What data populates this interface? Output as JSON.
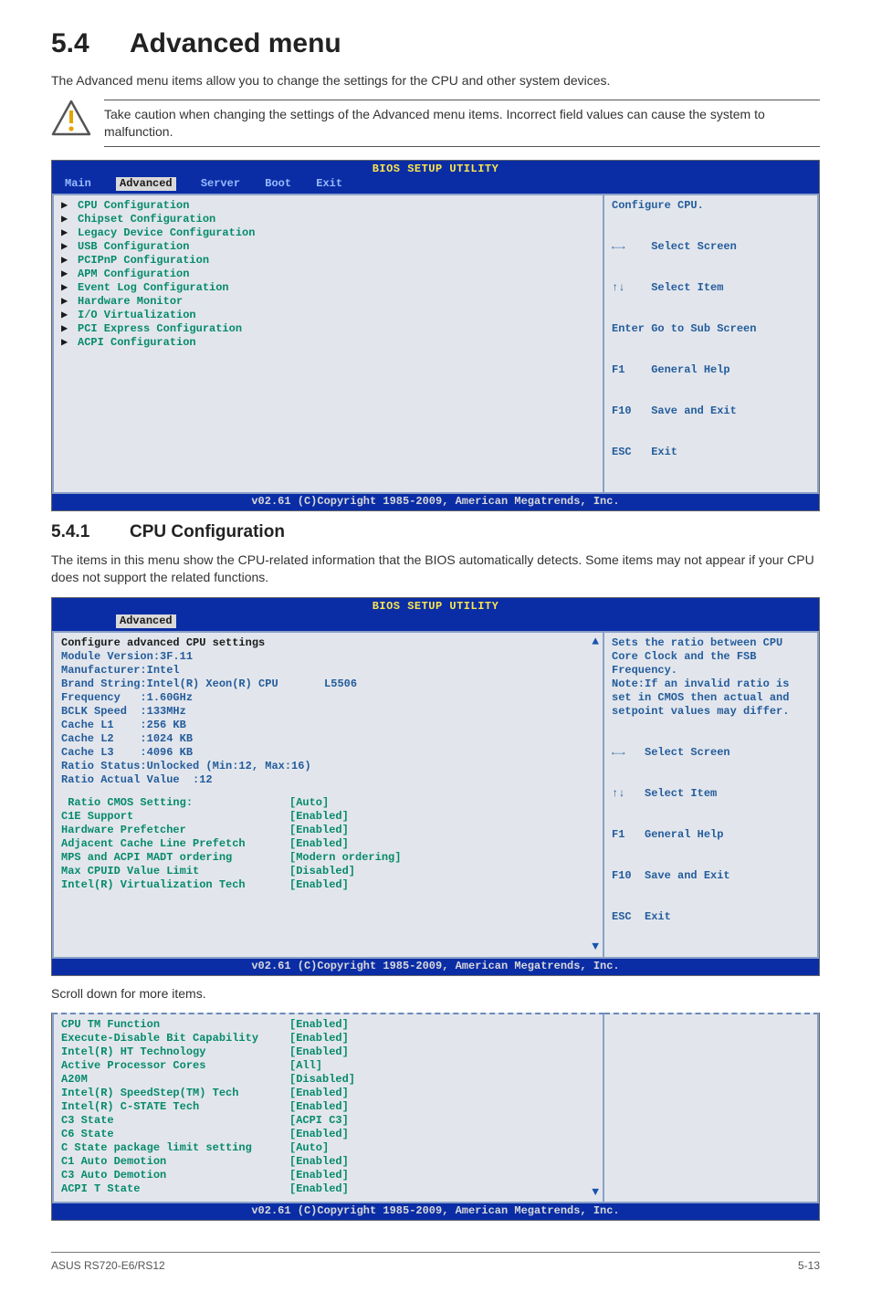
{
  "section": {
    "number": "5.4",
    "title": "Advanced menu"
  },
  "intro": "The Advanced menu items allow you to change the settings for the CPU and other system devices.",
  "note": "Take caution when changing the settings of the Advanced menu items. Incorrect field values can cause the system to malfunction.",
  "bios1": {
    "title": "BIOS SETUP UTILITY",
    "menus": [
      "Main",
      "Advanced",
      "Server",
      "Boot",
      "Exit"
    ],
    "selected_menu": "Advanced",
    "items": [
      "CPU Configuration",
      "Chipset Configuration",
      "Legacy Device Configuration",
      "USB Configuration",
      "PCIPnP Configuration",
      "APM Configuration",
      "Event Log Configuration",
      "Hardware Monitor",
      "I/O Virtualization",
      "PCI Express Configuration",
      "ACPI Configuration"
    ],
    "help_top": "Configure CPU.",
    "nav": [
      "←→    Select Screen",
      "↑↓    Select Item",
      "Enter Go to Sub Screen",
      "F1    General Help",
      "F10   Save and Exit",
      "ESC   Exit"
    ],
    "footer": "v02.61 (C)Copyright 1985-2009, American Megatrends, Inc."
  },
  "subsection": {
    "number": "5.4.1",
    "title": "CPU Configuration"
  },
  "sub_intro": "The items in this menu show the CPU-related information that the BIOS automatically detects. Some items may not appear if your CPU does not support the related functions.",
  "bios2": {
    "title": "BIOS SETUP UTILITY",
    "selected_menu": "Advanced",
    "heading": "Configure advanced CPU settings",
    "module": "Module Version:3F.11",
    "info_lines": [
      "Manufacturer:Intel",
      "Brand String:Intel(R) Xeon(R) CPU       L5506",
      "Frequency   :1.60GHz",
      "BCLK Speed  :133MHz",
      "Cache L1    :256 KB",
      "Cache L2    :1024 KB",
      "Cache L3    :4096 KB",
      "Ratio Status:Unlocked (Min:12, Max:16)",
      "Ratio Actual Value  :12"
    ],
    "options": [
      {
        "label": " Ratio CMOS Setting:",
        "value": "[Auto]"
      },
      {
        "label": "C1E Support",
        "value": "[Enabled]"
      },
      {
        "label": "Hardware Prefetcher",
        "value": "[Enabled]"
      },
      {
        "label": "Adjacent Cache Line Prefetch",
        "value": "[Enabled]"
      },
      {
        "label": "MPS and ACPI MADT ordering",
        "value": "[Modern ordering]"
      },
      {
        "label": "Max CPUID Value Limit",
        "value": "[Disabled]"
      },
      {
        "label": "Intel(R) Virtualization Tech",
        "value": "[Enabled]"
      }
    ],
    "help_top": "Sets the ratio between CPU Core Clock and the FSB Frequency.\nNote:If an invalid ratio is set in CMOS then actual and setpoint values may differ.",
    "nav": [
      "←→   Select Screen",
      "↑↓   Select Item",
      "F1   General Help",
      "F10  Save and Exit",
      "ESC  Exit"
    ],
    "footer": "v02.61 (C)Copyright 1985-2009, American Megatrends, Inc."
  },
  "scroll_note": "Scroll down for more items.",
  "bios3": {
    "options": [
      {
        "label": "CPU TM Function",
        "value": "[Enabled]"
      },
      {
        "label": "Execute-Disable Bit Capability",
        "value": "[Enabled]"
      },
      {
        "label": "Intel(R) HT Technology",
        "value": "[Enabled]"
      },
      {
        "label": "Active Processor Cores",
        "value": "[All]"
      },
      {
        "label": "A20M",
        "value": "[Disabled]"
      },
      {
        "label": "Intel(R) SpeedStep(TM) Tech",
        "value": "[Enabled]"
      },
      {
        "label": "Intel(R) C-STATE Tech",
        "value": "[Enabled]"
      },
      {
        "label": "C3 State",
        "value": "[ACPI C3]"
      },
      {
        "label": "C6 State",
        "value": "[Enabled]"
      },
      {
        "label": "C State package limit setting",
        "value": "[Auto]"
      },
      {
        "label": "C1 Auto Demotion",
        "value": "[Enabled]"
      },
      {
        "label": "C3 Auto Demotion",
        "value": "[Enabled]"
      },
      {
        "label": "ACPI T State",
        "value": "[Enabled]"
      }
    ],
    "footer": "v02.61 (C)Copyright 1985-2009, American Megatrends, Inc."
  },
  "page_footer_left": "ASUS RS720-E6/RS12",
  "page_footer_right": "5-13"
}
